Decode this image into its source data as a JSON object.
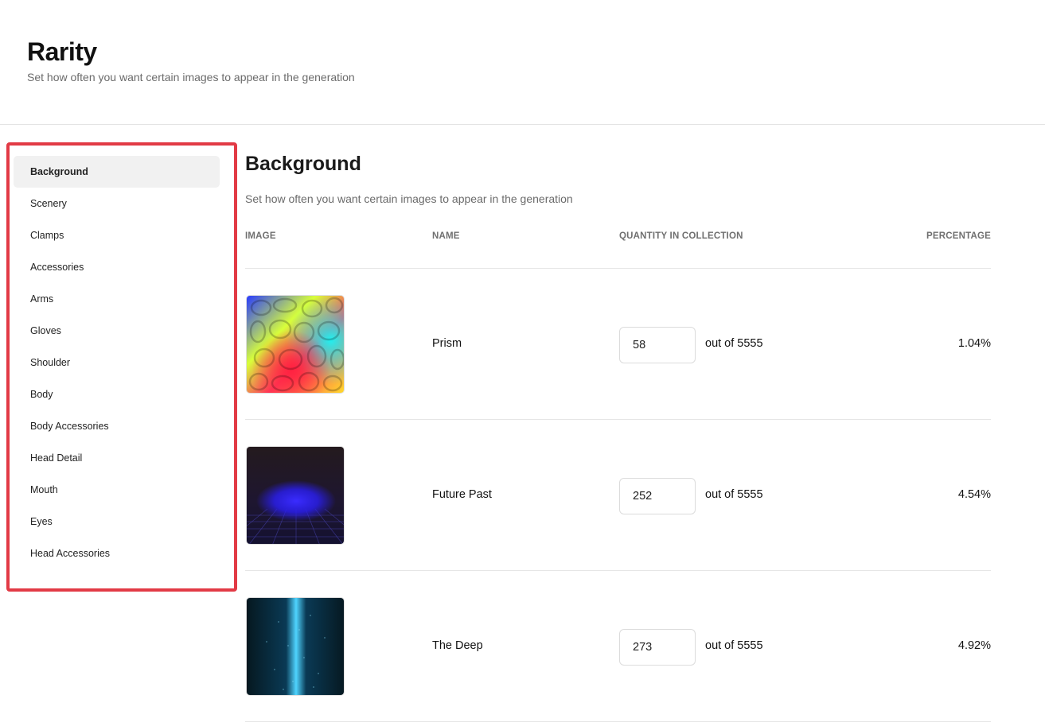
{
  "page": {
    "title": "Rarity",
    "subtitle": "Set how often you want certain images to appear in the generation"
  },
  "sidebar": {
    "items": [
      {
        "label": "Background",
        "active": true
      },
      {
        "label": "Scenery"
      },
      {
        "label": "Clamps"
      },
      {
        "label": "Accessories"
      },
      {
        "label": "Arms"
      },
      {
        "label": "Gloves"
      },
      {
        "label": "Shoulder"
      },
      {
        "label": "Body"
      },
      {
        "label": "Body Accessories"
      },
      {
        "label": "Head Detail"
      },
      {
        "label": "Mouth"
      },
      {
        "label": "Eyes"
      },
      {
        "label": "Head Accessories"
      }
    ],
    "highlight_color": "#e23a45"
  },
  "section": {
    "title": "Background",
    "subtitle": "Set how often you want certain images to appear in the generation"
  },
  "table": {
    "headers": {
      "image": "IMAGE",
      "name": "NAME",
      "quantity": "QUANTITY IN COLLECTION",
      "percentage": "PERCENTAGE"
    },
    "rows": [
      {
        "name": "Prism",
        "quantity": "58",
        "out_of": "out of 5555",
        "percentage": "1.04%",
        "image_icon": "prism-thumbnail"
      },
      {
        "name": "Future Past",
        "quantity": "252",
        "out_of": "out of 5555",
        "percentage": "4.54%",
        "image_icon": "future-past-thumbnail"
      },
      {
        "name": "The Deep",
        "quantity": "273",
        "out_of": "out of 5555",
        "percentage": "4.92%",
        "image_icon": "the-deep-thumbnail"
      }
    ]
  }
}
